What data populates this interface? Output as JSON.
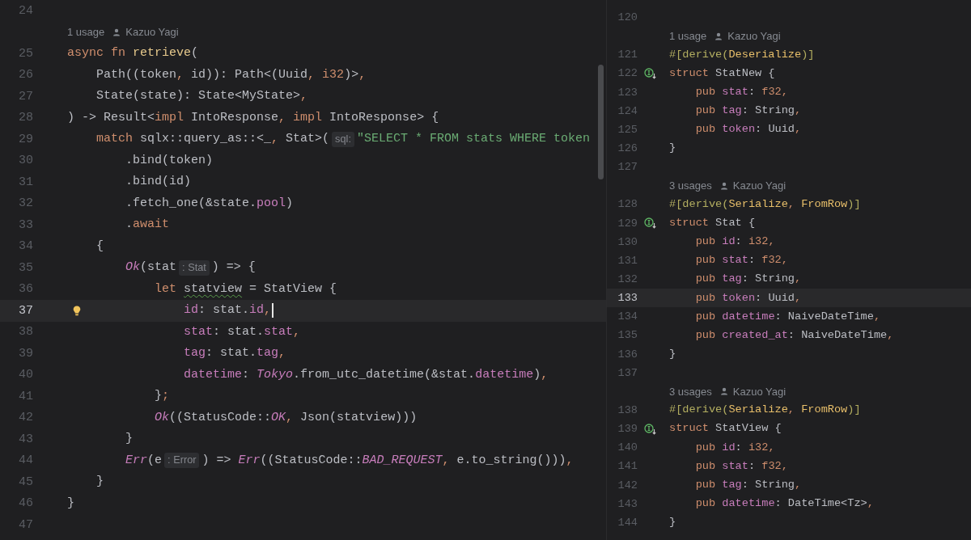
{
  "panes": [
    {
      "lines": [
        {
          "kind": "code",
          "number": "24",
          "current": false,
          "caret": false
        },
        {
          "kind": "lens",
          "usages": "1 usage",
          "author": "Kazuo Yagi"
        },
        {
          "kind": "code",
          "number": "25",
          "tokens": [
            {
              "text": "async fn ",
              "kind": "kw"
            },
            {
              "text": "retrieve",
              "kind": "fn"
            },
            {
              "text": "(",
              "kind": "p"
            }
          ],
          "current": false,
          "caret": false
        },
        {
          "kind": "code",
          "number": "26",
          "tokens": [
            {
              "text": "    Path((token",
              "kind": "p"
            },
            {
              "text": ", ",
              "kind": "c"
            },
            {
              "text": "id)): Path<(Uuid",
              "kind": "p"
            },
            {
              "text": ", ",
              "kind": "c"
            },
            {
              "text": "i32",
              "kind": "kw"
            },
            {
              "text": ")>",
              "kind": "p"
            },
            {
              "text": ",",
              "kind": "c"
            }
          ],
          "current": false,
          "caret": false
        },
        {
          "kind": "code",
          "number": "27",
          "tokens": [
            {
              "text": "    State(state): State<MyState>",
              "kind": "p"
            },
            {
              "text": ",",
              "kind": "c"
            }
          ],
          "current": false,
          "caret": false
        },
        {
          "kind": "code",
          "number": "28",
          "tokens": [
            {
              "text": ") -> Result<",
              "kind": "p"
            },
            {
              "text": "impl ",
              "kind": "kw"
            },
            {
              "text": "IntoResponse",
              "kind": "p"
            },
            {
              "text": ", ",
              "kind": "c"
            },
            {
              "text": "impl ",
              "kind": "kw"
            },
            {
              "text": "IntoResponse> {",
              "kind": "p"
            }
          ],
          "current": false,
          "caret": false
        },
        {
          "kind": "code",
          "number": "29",
          "tokens": [
            {
              "text": "    match ",
              "kind": "kw"
            },
            {
              "text": "sqlx::query_as::<_",
              "kind": "p"
            },
            {
              "text": ", ",
              "kind": "c"
            },
            {
              "text": "Stat>(",
              "kind": "p"
            },
            {
              "text": "sql:",
              "kind": "hint"
            },
            {
              "text": "\"SELECT * FROM stats WHERE token",
              "kind": "str"
            }
          ],
          "current": false,
          "caret": false
        },
        {
          "kind": "code",
          "number": "30",
          "tokens": [
            {
              "text": "        .bind(token)",
              "kind": "p"
            }
          ],
          "current": false,
          "caret": false
        },
        {
          "kind": "code",
          "number": "31",
          "tokens": [
            {
              "text": "        .bind(id)",
              "kind": "p"
            }
          ],
          "current": false,
          "caret": false
        },
        {
          "kind": "code",
          "number": "32",
          "tokens": [
            {
              "text": "        .fetch_one(&state.",
              "kind": "p"
            },
            {
              "text": "pool",
              "kind": "field"
            },
            {
              "text": ")",
              "kind": "p"
            }
          ],
          "current": false,
          "caret": false
        },
        {
          "kind": "code",
          "number": "33",
          "tokens": [
            {
              "text": "        .",
              "kind": "p"
            },
            {
              "text": "await",
              "kind": "kw"
            }
          ],
          "current": false,
          "caret": false
        },
        {
          "kind": "code",
          "number": "34",
          "tokens": [
            {
              "text": "    {",
              "kind": "p"
            }
          ],
          "current": false,
          "caret": false
        },
        {
          "kind": "code",
          "number": "35",
          "tokens": [
            {
              "text": "        Ok",
              "kind": "enum"
            },
            {
              "text": "(stat",
              "kind": "p"
            },
            {
              "text": ": Stat",
              "kind": "hint"
            },
            {
              "text": ") => {",
              "kind": "p"
            }
          ],
          "current": false,
          "caret": false
        },
        {
          "kind": "code",
          "number": "36",
          "tokens": [
            {
              "text": "            let ",
              "kind": "kw"
            },
            {
              "text": "statview",
              "kind": "warn"
            },
            {
              "text": " = StatView {",
              "kind": "p"
            }
          ],
          "current": false,
          "caret": false
        },
        {
          "kind": "code",
          "number": "37",
          "gutter_icon": {
            "kind": "bulb"
          },
          "tokens": [
            {
              "text": "                id",
              "kind": "field"
            },
            {
              "text": ": stat.",
              "kind": "p"
            },
            {
              "text": "id",
              "kind": "field"
            },
            {
              "text": ",",
              "kind": "c"
            }
          ],
          "current": true,
          "caret": true
        },
        {
          "kind": "code",
          "number": "38",
          "tokens": [
            {
              "text": "                stat",
              "kind": "field"
            },
            {
              "text": ": stat.",
              "kind": "p"
            },
            {
              "text": "stat",
              "kind": "field"
            },
            {
              "text": ",",
              "kind": "c"
            }
          ],
          "current": false,
          "caret": false
        },
        {
          "kind": "code",
          "number": "39",
          "tokens": [
            {
              "text": "                tag",
              "kind": "field"
            },
            {
              "text": ": stat.",
              "kind": "p"
            },
            {
              "text": "tag",
              "kind": "field"
            },
            {
              "text": ",",
              "kind": "c"
            }
          ],
          "current": false,
          "caret": false
        },
        {
          "kind": "code",
          "number": "40",
          "tokens": [
            {
              "text": "                datetime",
              "kind": "field"
            },
            {
              "text": ": ",
              "kind": "p"
            },
            {
              "text": "Tokyo",
              "kind": "enum"
            },
            {
              "text": ".from_utc_datetime(&stat.",
              "kind": "p"
            },
            {
              "text": "datetime",
              "kind": "field"
            },
            {
              "text": ")",
              "kind": "p"
            },
            {
              "text": ",",
              "kind": "c"
            }
          ],
          "current": false,
          "caret": false
        },
        {
          "kind": "code",
          "number": "41",
          "tokens": [
            {
              "text": "            }",
              "kind": "p"
            },
            {
              "text": ";",
              "kind": "c"
            }
          ],
          "current": false,
          "caret": false
        },
        {
          "kind": "code",
          "number": "42",
          "tokens": [
            {
              "text": "            Ok",
              "kind": "enum"
            },
            {
              "text": "((StatusCode::",
              "kind": "p"
            },
            {
              "text": "OK",
              "kind": "enum"
            },
            {
              "text": ", ",
              "kind": "c"
            },
            {
              "text": "Json(statview)))",
              "kind": "p"
            }
          ],
          "current": false,
          "caret": false
        },
        {
          "kind": "code",
          "number": "43",
          "tokens": [
            {
              "text": "        }",
              "kind": "p"
            }
          ],
          "current": false,
          "caret": false
        },
        {
          "kind": "code",
          "number": "44",
          "tokens": [
            {
              "text": "        Err",
              "kind": "enum"
            },
            {
              "text": "(e",
              "kind": "p"
            },
            {
              "text": ": Error",
              "kind": "hint"
            },
            {
              "text": ") => ",
              "kind": "p"
            },
            {
              "text": "Err",
              "kind": "enum"
            },
            {
              "text": "((StatusCode::",
              "kind": "p"
            },
            {
              "text": "BAD_REQUEST",
              "kind": "enum"
            },
            {
              "text": ", ",
              "kind": "c"
            },
            {
              "text": "e.to_string()))",
              "kind": "p"
            },
            {
              "text": ",",
              "kind": "c"
            }
          ],
          "current": false,
          "caret": false
        },
        {
          "kind": "code",
          "number": "45",
          "tokens": [
            {
              "text": "    }",
              "kind": "p"
            }
          ],
          "current": false,
          "caret": false
        },
        {
          "kind": "code",
          "number": "46",
          "tokens": [
            {
              "text": "}",
              "kind": "p"
            }
          ],
          "current": false,
          "caret": false
        },
        {
          "kind": "code",
          "number": "47",
          "current": false,
          "caret": false
        }
      ]
    },
    {
      "lines": [
        {
          "kind": "code",
          "number": "120",
          "current": false,
          "caret": false
        },
        {
          "kind": "lens",
          "usages": "1 usage",
          "author": "Kazuo Yagi"
        },
        {
          "kind": "code",
          "number": "121",
          "tokens": [
            {
              "text": "#[derive(",
              "kind": "attr"
            },
            {
              "text": "Deserialize",
              "kind": "attrname"
            },
            {
              "text": ")]",
              "kind": "attr"
            }
          ],
          "current": false,
          "caret": false
        },
        {
          "kind": "code",
          "number": "122",
          "gutter_icon": {
            "kind": "implemented"
          },
          "tokens": [
            {
              "text": "struct ",
              "kind": "kw"
            },
            {
              "text": "StatNew {",
              "kind": "p"
            }
          ],
          "current": false,
          "caret": false
        },
        {
          "kind": "code",
          "number": "123",
          "tokens": [
            {
              "text": "    pub ",
              "kind": "kw"
            },
            {
              "text": "stat",
              "kind": "field"
            },
            {
              "text": ": ",
              "kind": "p"
            },
            {
              "text": "f32",
              "kind": "kw"
            },
            {
              "text": ",",
              "kind": "c"
            }
          ],
          "current": false,
          "caret": false
        },
        {
          "kind": "code",
          "number": "124",
          "tokens": [
            {
              "text": "    pub ",
              "kind": "kw"
            },
            {
              "text": "tag",
              "kind": "field"
            },
            {
              "text": ": String",
              "kind": "p"
            },
            {
              "text": ",",
              "kind": "c"
            }
          ],
          "current": false,
          "caret": false
        },
        {
          "kind": "code",
          "number": "125",
          "tokens": [
            {
              "text": "    pub ",
              "kind": "kw"
            },
            {
              "text": "token",
              "kind": "field"
            },
            {
              "text": ": Uuid",
              "kind": "p"
            },
            {
              "text": ",",
              "kind": "c"
            }
          ],
          "current": false,
          "caret": false
        },
        {
          "kind": "code",
          "number": "126",
          "tokens": [
            {
              "text": "}",
              "kind": "p"
            }
          ],
          "current": false,
          "caret": false
        },
        {
          "kind": "code",
          "number": "127",
          "current": false,
          "caret": false
        },
        {
          "kind": "lens",
          "usages": "3 usages",
          "author": "Kazuo Yagi"
        },
        {
          "kind": "code",
          "number": "128",
          "tokens": [
            {
              "text": "#[derive(",
              "kind": "attr"
            },
            {
              "text": "Serialize",
              "kind": "attrname"
            },
            {
              "text": ", ",
              "kind": "c"
            },
            {
              "text": "FromRow",
              "kind": "attrname"
            },
            {
              "text": ")]",
              "kind": "attr"
            }
          ],
          "current": false,
          "caret": false
        },
        {
          "kind": "code",
          "number": "129",
          "gutter_icon": {
            "kind": "implemented"
          },
          "tokens": [
            {
              "text": "struct ",
              "kind": "kw"
            },
            {
              "text": "Stat {",
              "kind": "p"
            }
          ],
          "current": false,
          "caret": false
        },
        {
          "kind": "code",
          "number": "130",
          "tokens": [
            {
              "text": "    pub ",
              "kind": "kw"
            },
            {
              "text": "id",
              "kind": "field"
            },
            {
              "text": ": ",
              "kind": "p"
            },
            {
              "text": "i32",
              "kind": "kw"
            },
            {
              "text": ",",
              "kind": "c"
            }
          ],
          "current": false,
          "caret": false
        },
        {
          "kind": "code",
          "number": "131",
          "tokens": [
            {
              "text": "    pub ",
              "kind": "kw"
            },
            {
              "text": "stat",
              "kind": "field"
            },
            {
              "text": ": ",
              "kind": "p"
            },
            {
              "text": "f32",
              "kind": "kw"
            },
            {
              "text": ",",
              "kind": "c"
            }
          ],
          "current": false,
          "caret": false
        },
        {
          "kind": "code",
          "number": "132",
          "tokens": [
            {
              "text": "    pub ",
              "kind": "kw"
            },
            {
              "text": "tag",
              "kind": "field"
            },
            {
              "text": ": String",
              "kind": "p"
            },
            {
              "text": ",",
              "kind": "c"
            }
          ],
          "current": false,
          "caret": false
        },
        {
          "kind": "code",
          "number": "133",
          "tokens": [
            {
              "text": "    pub ",
              "kind": "kw"
            },
            {
              "text": "token",
              "kind": "field"
            },
            {
              "text": ": Uuid",
              "kind": "p"
            },
            {
              "text": ",",
              "kind": "c"
            }
          ],
          "current": true,
          "caret": false
        },
        {
          "kind": "code",
          "number": "134",
          "tokens": [
            {
              "text": "    pub ",
              "kind": "kw"
            },
            {
              "text": "datetime",
              "kind": "field"
            },
            {
              "text": ": NaiveDateTime",
              "kind": "p"
            },
            {
              "text": ",",
              "kind": "c"
            }
          ],
          "current": false,
          "caret": false
        },
        {
          "kind": "code",
          "number": "135",
          "tokens": [
            {
              "text": "    pub ",
              "kind": "kw"
            },
            {
              "text": "created_at",
              "kind": "field"
            },
            {
              "text": ": NaiveDateTime",
              "kind": "p"
            },
            {
              "text": ",",
              "kind": "c"
            }
          ],
          "current": false,
          "caret": false
        },
        {
          "kind": "code",
          "number": "136",
          "tokens": [
            {
              "text": "}",
              "kind": "p"
            }
          ],
          "current": false,
          "caret": false
        },
        {
          "kind": "code",
          "number": "137",
          "current": false,
          "caret": false
        },
        {
          "kind": "lens",
          "usages": "3 usages",
          "author": "Kazuo Yagi"
        },
        {
          "kind": "code",
          "number": "138",
          "tokens": [
            {
              "text": "#[derive(",
              "kind": "attr"
            },
            {
              "text": "Serialize",
              "kind": "attrname"
            },
            {
              "text": ", ",
              "kind": "c"
            },
            {
              "text": "FromRow",
              "kind": "attrname"
            },
            {
              "text": ")]",
              "kind": "attr"
            }
          ],
          "current": false,
          "caret": false
        },
        {
          "kind": "code",
          "number": "139",
          "gutter_icon": {
            "kind": "implemented"
          },
          "tokens": [
            {
              "text": "struct ",
              "kind": "kw"
            },
            {
              "text": "StatView {",
              "kind": "p"
            }
          ],
          "current": false,
          "caret": false
        },
        {
          "kind": "code",
          "number": "140",
          "tokens": [
            {
              "text": "    pub ",
              "kind": "kw"
            },
            {
              "text": "id",
              "kind": "field"
            },
            {
              "text": ": ",
              "kind": "p"
            },
            {
              "text": "i32",
              "kind": "kw"
            },
            {
              "text": ",",
              "kind": "c"
            }
          ],
          "current": false,
          "caret": false
        },
        {
          "kind": "code",
          "number": "141",
          "tokens": [
            {
              "text": "    pub ",
              "kind": "kw"
            },
            {
              "text": "stat",
              "kind": "field"
            },
            {
              "text": ": ",
              "kind": "p"
            },
            {
              "text": "f32",
              "kind": "kw"
            },
            {
              "text": ",",
              "kind": "c"
            }
          ],
          "current": false,
          "caret": false
        },
        {
          "kind": "code",
          "number": "142",
          "tokens": [
            {
              "text": "    pub ",
              "kind": "kw"
            },
            {
              "text": "tag",
              "kind": "field"
            },
            {
              "text": ": String",
              "kind": "p"
            },
            {
              "text": ",",
              "kind": "c"
            }
          ],
          "current": false,
          "caret": false
        },
        {
          "kind": "code",
          "number": "143",
          "tokens": [
            {
              "text": "    pub ",
              "kind": "kw"
            },
            {
              "text": "datetime",
              "kind": "field"
            },
            {
              "text": ": DateTime<Tz>",
              "kind": "p"
            },
            {
              "text": ",",
              "kind": "c"
            }
          ],
          "current": false,
          "caret": false
        },
        {
          "kind": "code",
          "number": "144",
          "tokens": [
            {
              "text": "}",
              "kind": "p"
            }
          ],
          "current": false,
          "caret": false
        }
      ]
    }
  ]
}
